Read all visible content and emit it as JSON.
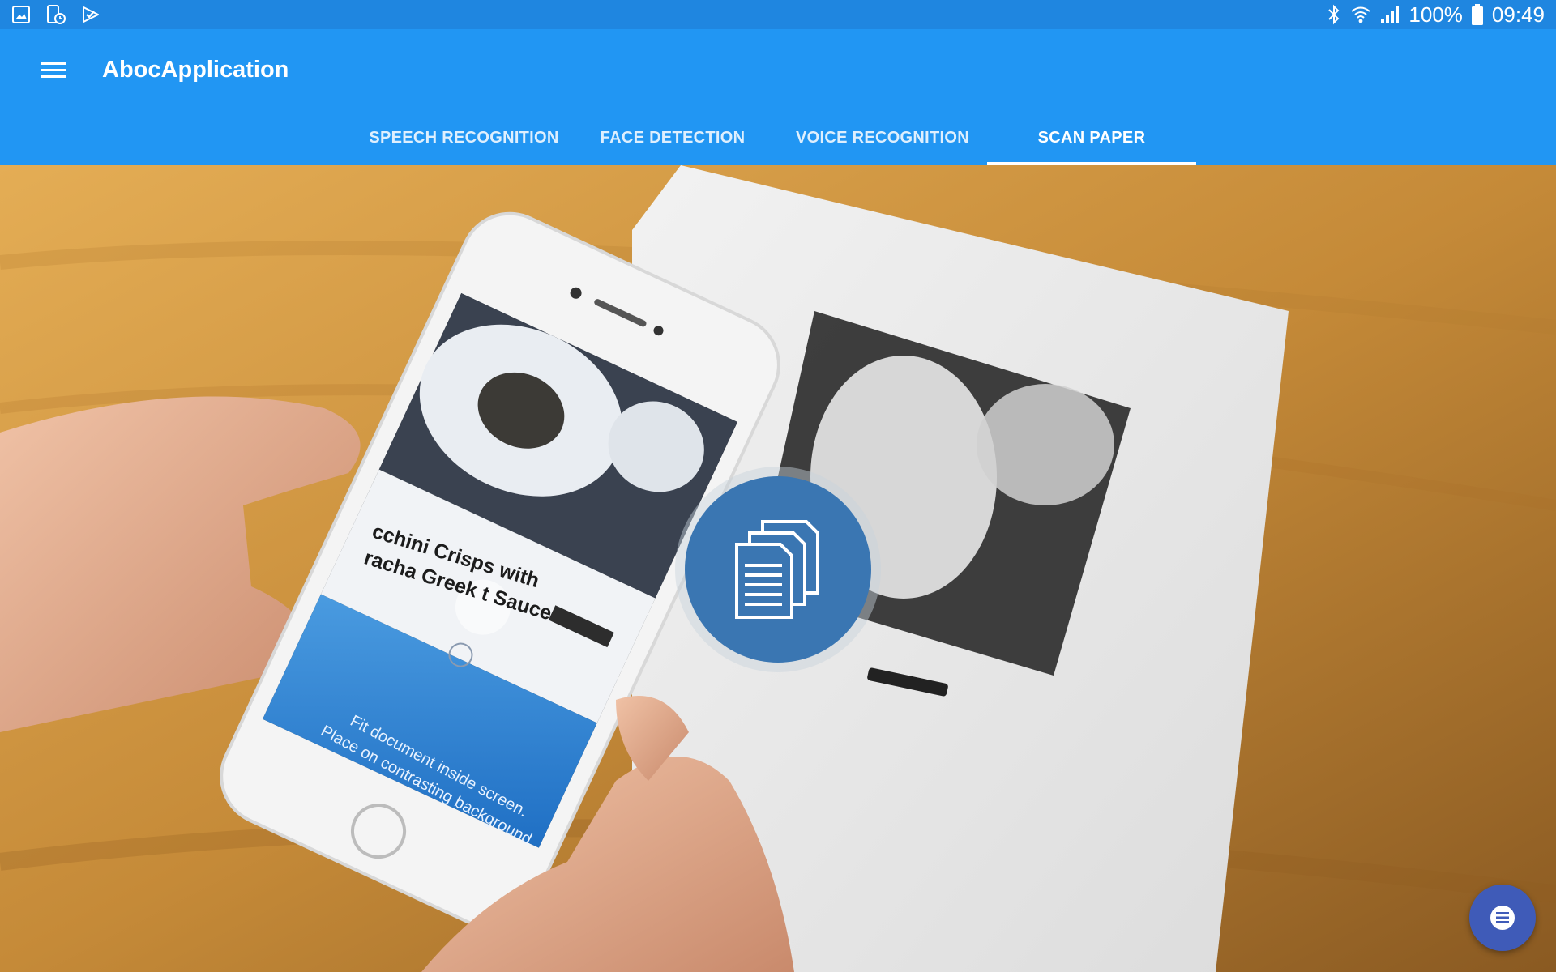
{
  "status_bar": {
    "battery_percent": "100%",
    "time": "09:49",
    "left_icons": [
      "image-icon",
      "device-clock-icon",
      "play-check-icon"
    ],
    "right_icons": [
      "bluetooth-icon",
      "wifi-icon",
      "signal-icon",
      "battery-icon"
    ]
  },
  "appbar": {
    "title": "AbocApplication",
    "menu_icon": "hamburger-menu-icon"
  },
  "tabs": [
    {
      "label": "SPEECH RECOGNITION",
      "active": false
    },
    {
      "label": "FACE DETECTION",
      "active": false
    },
    {
      "label": "VOICE RECOGNITION",
      "active": false
    },
    {
      "label": "SCAN PAPER",
      "active": true
    }
  ],
  "hero": {
    "phone_dish_line1": "cchini Crisps with",
    "phone_dish_line2": "racha Greek    t Sauce",
    "phone_caption_line1": "Fit document inside screen.",
    "phone_caption_line2": "Place on contrasting background."
  },
  "actions": {
    "scan_icon": "documents-stack-icon",
    "fab_icon": "list-menu-icon"
  },
  "colors": {
    "status_bar": "#1f86e0",
    "app_bar": "#2196f3",
    "scan_button": "#3a76b2",
    "fab": "#3f5bb8"
  }
}
